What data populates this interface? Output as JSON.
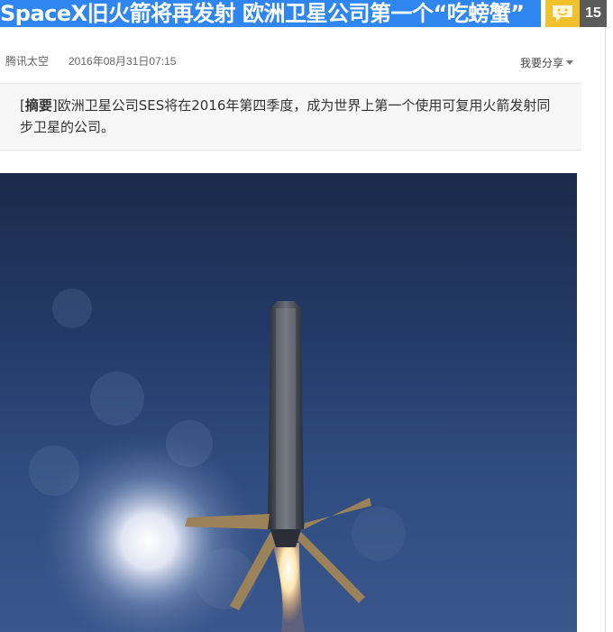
{
  "article": {
    "title": "SpaceX旧火箭将再发射 欧洲卫星公司第一个“吃螃蟹”",
    "comment_count": "15",
    "source": "腾讯太空",
    "timestamp": "2016年08月31日07:15",
    "share_label": "我要分享",
    "summary_label": "摘要",
    "summary_text": "欧洲卫星公司SES将在2016年第四季度，成为世界上第一个使用可复用火箭发射同步卫星的公司。"
  },
  "icons": {
    "comment": "speech-bubble-smiley-icon",
    "share": "caret-down-icon"
  },
  "colors": {
    "title_bg": "#2f86f0",
    "comment_icon_bg": "#f1c12b",
    "comment_count_bg": "#5b5b5b",
    "summary_bg": "#f7f7f7"
  }
}
